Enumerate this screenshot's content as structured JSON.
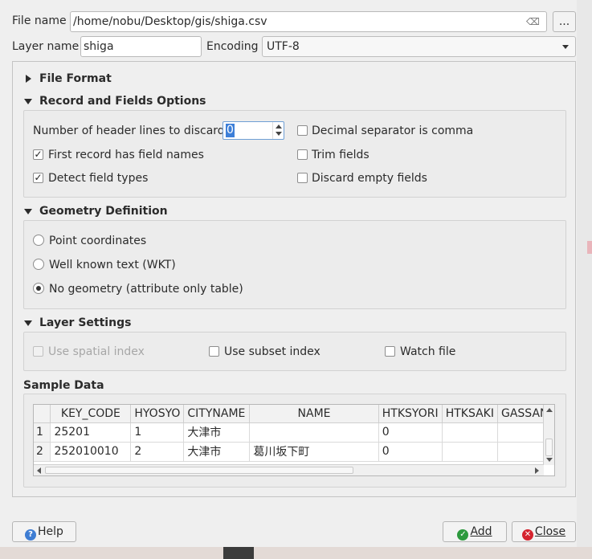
{
  "file": {
    "label": "File name",
    "path": "/home/nobu/Desktop/gis/shiga.csv",
    "browse_label": "..."
  },
  "layer": {
    "label": "Layer name",
    "value": "shiga",
    "encoding_label": "Encoding",
    "encoding_value": "UTF-8"
  },
  "sections": {
    "file_format": "File Format",
    "record_fields": "Record and Fields Options",
    "geometry": "Geometry Definition",
    "layer_settings": "Layer Settings",
    "sample_data": "Sample Data"
  },
  "record_options": {
    "header_lines_label": "Number of header lines to discard",
    "header_lines_value": "0",
    "decimal_comma": "Decimal separator is comma",
    "first_record_names": "First record has field names",
    "trim_fields": "Trim fields",
    "detect_types": "Detect field types",
    "discard_empty": "Discard empty fields",
    "check_mark": "✓"
  },
  "geometry": {
    "point": "Point coordinates",
    "wkt": "Well known text (WKT)",
    "none": "No geometry (attribute only table)"
  },
  "layer_settings": {
    "spatial_index": "Use spatial index",
    "subset_index": "Use subset index",
    "watch_file": "Watch file"
  },
  "sample_table": {
    "columns": [
      "KEY_CODE",
      "HYOSYO",
      "CITYNAME",
      "NAME",
      "HTKSYORI",
      "HTKSAKI",
      "GASSAN"
    ],
    "rows": [
      {
        "num": "1",
        "cells": [
          "25201",
          "1",
          "大津市",
          "",
          "0",
          "",
          ""
        ]
      },
      {
        "num": "2",
        "cells": [
          "252010010",
          "2",
          "大津市",
          "葛川坂下町",
          "0",
          "",
          ""
        ]
      }
    ]
  },
  "buttons": {
    "help": "Help",
    "add": "Add",
    "close": "Close",
    "help_icon": "?",
    "add_icon": "✓",
    "close_icon": "✕"
  },
  "colors": {
    "accent": "#3d7fd8",
    "add_green": "#2d9a3e",
    "close_red": "#d5242f"
  }
}
